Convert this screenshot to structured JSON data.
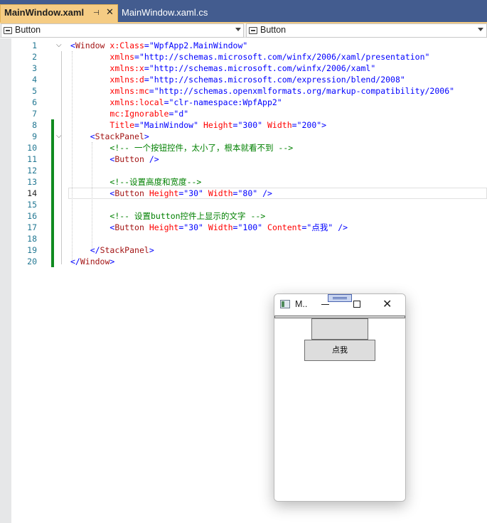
{
  "tabs": [
    {
      "label": "MainWindow.xaml",
      "active": true
    },
    {
      "label": "MainWindow.xaml.cs",
      "active": false
    }
  ],
  "tab_icons": {
    "pin": "pin-icon",
    "close": "close-icon"
  },
  "navbar": {
    "left_dropdown": {
      "value": "Button",
      "icon": "element-icon"
    },
    "right_dropdown": {
      "value": "Button",
      "icon": "element-icon"
    }
  },
  "editor": {
    "current_line": 14,
    "line_numbers": [
      "1",
      "2",
      "3",
      "4",
      "5",
      "6",
      "7",
      "8",
      "9",
      "10",
      "11",
      "12",
      "13",
      "14",
      "15",
      "16",
      "17",
      "18",
      "19",
      "20"
    ]
  },
  "colors": {
    "tab_active": "#f5cc84",
    "tab_bar": "#435c8f",
    "change_bar": "#108b20",
    "xml_tag": "#a31515",
    "xml_attr": "#ff0000",
    "xml_value": "#0000ff",
    "xml_comment": "#008000"
  },
  "preview_window": {
    "title": "M..",
    "buttons": {
      "minimize": "minimize-icon",
      "maximize": "maximize-icon",
      "close": "close-icon"
    },
    "button_content": "点我"
  }
}
